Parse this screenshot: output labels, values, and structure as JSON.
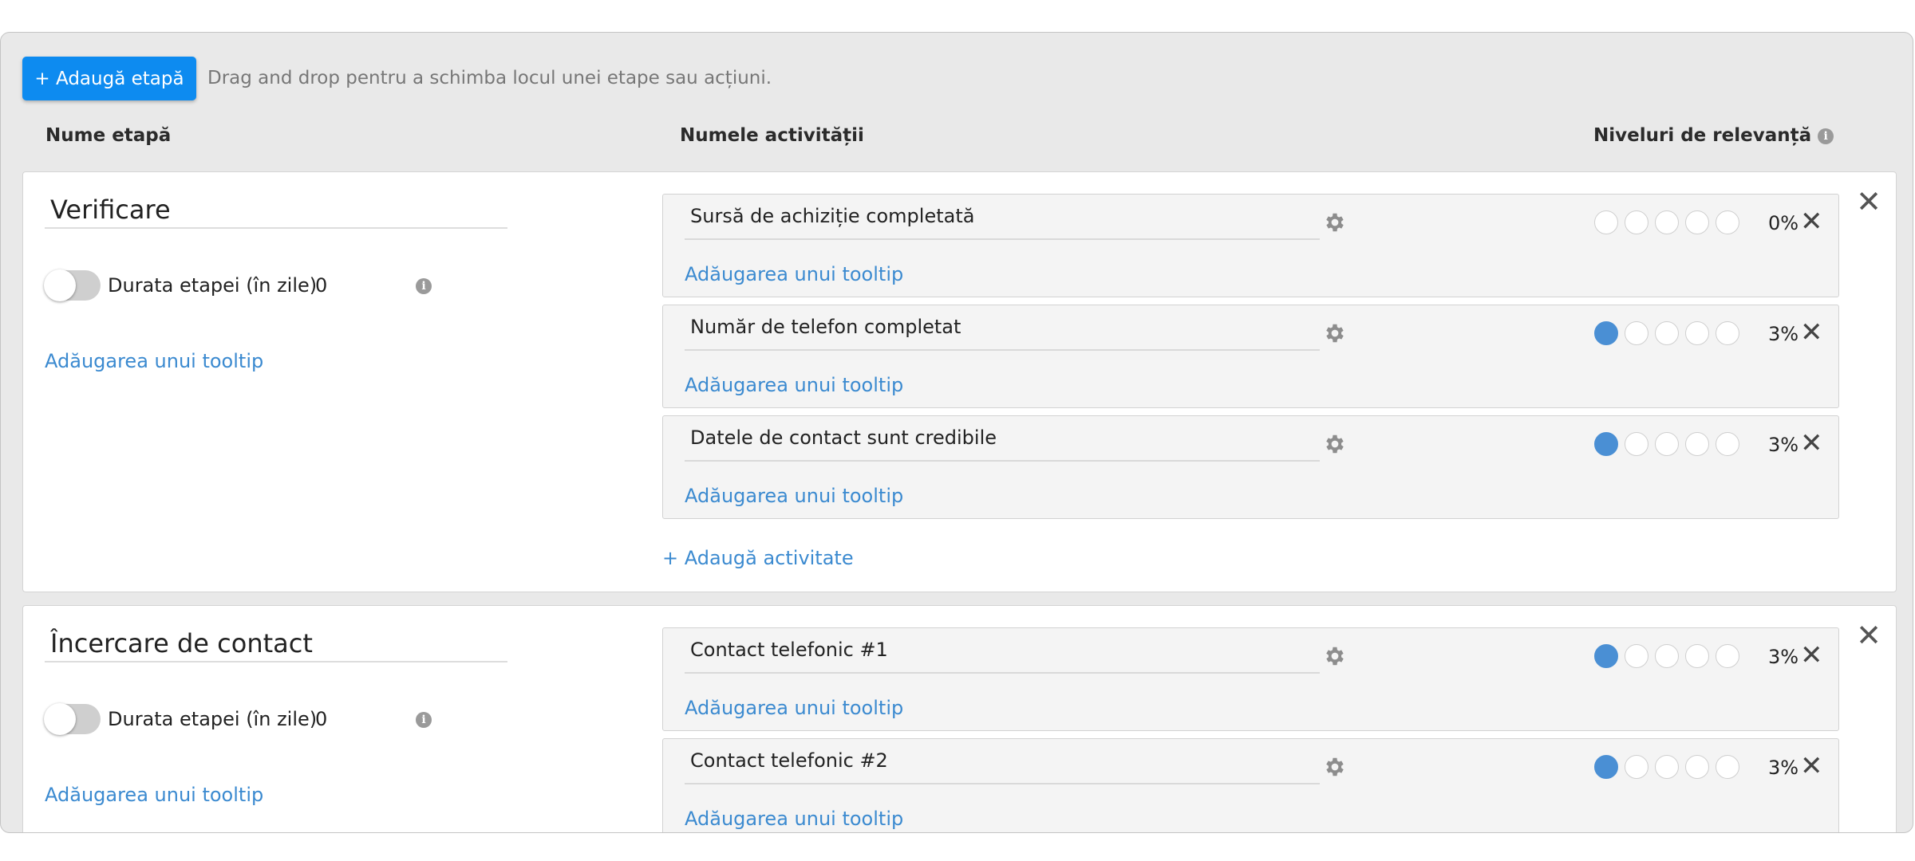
{
  "toolbar": {
    "add_stage_label": "+ Adaugă etapă",
    "hint": "Drag and drop pentru a schimba locul unei etape sau acțiuni."
  },
  "headers": {
    "stage_name": "Nume etapă",
    "activity_name": "Numele activității",
    "relevance": "Niveluri de relevanță"
  },
  "colors": {
    "accent": "#0d8bf0",
    "link": "#3b8ad0",
    "rating_filled": "#4a8fd4"
  },
  "stages": [
    {
      "name": "Verificare",
      "duration_label": "Durata etapei (în zile)",
      "duration_value": "0",
      "tooltip_link": "Adăugarea unui tooltip",
      "add_activity_label": "+ Adaugă activitate",
      "activities": [
        {
          "name": "Sursă de achiziție completată",
          "tooltip_link": "Adăugarea unui tooltip",
          "rating_filled": 0,
          "percent": "0%"
        },
        {
          "name": "Număr de telefon completat",
          "tooltip_link": "Adăugarea unui tooltip",
          "rating_filled": 1,
          "percent": "3%"
        },
        {
          "name": "Datele de contact sunt credibile",
          "tooltip_link": "Adăugarea unui tooltip",
          "rating_filled": 1,
          "percent": "3%"
        }
      ]
    },
    {
      "name": "Încercare de contact",
      "duration_label": "Durata etapei (în zile)",
      "duration_value": "0",
      "tooltip_link": "Adăugarea unui tooltip",
      "activities": [
        {
          "name": "Contact telefonic #1",
          "tooltip_link": "Adăugarea unui tooltip",
          "rating_filled": 1,
          "percent": "3%"
        },
        {
          "name": "Contact telefonic #2",
          "tooltip_link": "Adăugarea unui tooltip",
          "rating_filled": 1,
          "percent": "3%"
        }
      ]
    }
  ]
}
